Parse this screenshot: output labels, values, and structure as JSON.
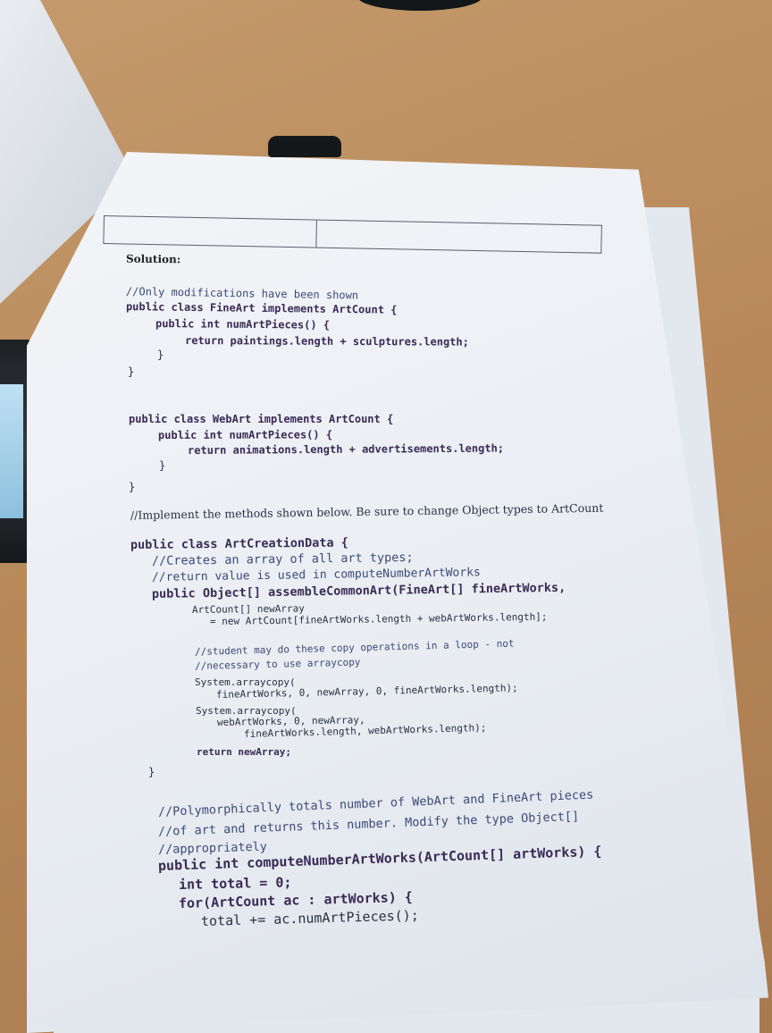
{
  "document": {
    "heading": "Solution:",
    "lines": [
      "//Only modifications have been shown",
      "public class FineArt implements ArtCount {",
      "public int numArtPieces() {",
      "return paintings.length + sculptures.length;",
      "}",
      "}",
      "public class WebArt implements ArtCount {",
      "public int numArtPieces() {",
      "return animations.length + advertisements.length;",
      "}",
      "}",
      "//Implement the methods shown below. Be sure to change Object types to ArtCount",
      "public class ArtCreationData {",
      "//Creates an array of all art types;",
      "//return value is used in computeNumberArtWorks",
      "public Object[] assembleCommonArt(FineArt[] fineArtWorks,",
      "ArtCount[] newArray",
      "= new ArtCount[fineArtWorks.length + webArtWorks.length];",
      "//student may do these copy operations in a loop - not",
      "//necessary to use arraycopy",
      "System.arraycopy(",
      "fineArtWorks, 0, newArray, 0, fineArtWorks.length);",
      "System.arraycopy(",
      "webArtWorks, 0, newArray,",
      "fineArtWorks.length, webArtWorks.length);",
      "return newArray;",
      "}",
      "//Polymorphically totals number of WebArt and FineArt pieces",
      "//of art and returns this number. Modify the type Object[]",
      "//appropriately",
      "public int computeNumberArtWorks(ArtCount[] artWorks) {",
      "int total = 0;",
      "for(ArtCount ac : artWorks) {",
      "total += ac.numArtPieces();"
    ]
  }
}
